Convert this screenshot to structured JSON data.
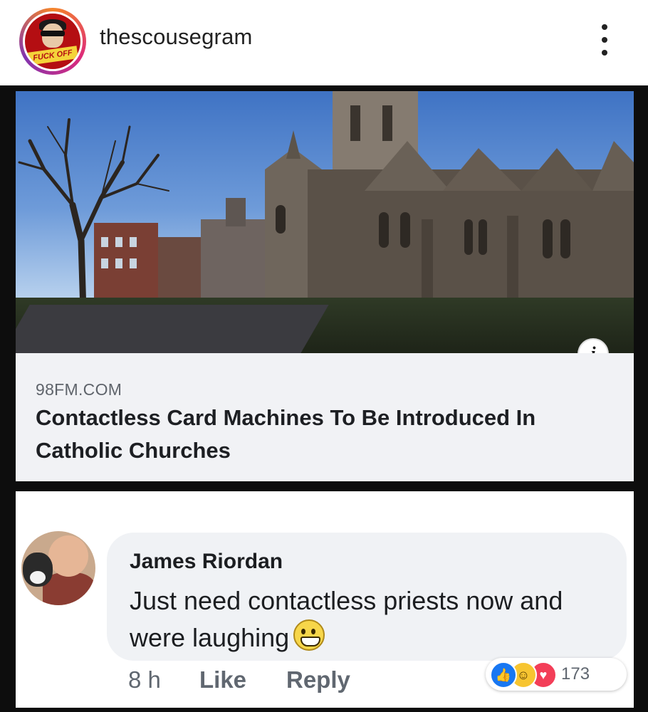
{
  "instagram": {
    "username": "thescousegram",
    "avatar_badge_text": "FUCK OFF",
    "menu_icon": "more-vertical-icon"
  },
  "link_card": {
    "domain": "98FM.COM",
    "headline": "Contactless Card Machines To Be Introduced In Catholic Churches",
    "info_icon_glyph": "i"
  },
  "comment": {
    "author": "James Riordan",
    "text": "Just need contactless priests now and were laughing",
    "emoji": "grinning-face-icon",
    "time": "8 h",
    "like_label": "Like",
    "reply_label": "Reply",
    "reaction_count": "173",
    "reactions": [
      "like-icon",
      "haha-icon",
      "love-icon"
    ]
  },
  "colors": {
    "facebook_blue": "#1877f2",
    "love_red": "#f33e58",
    "haha_yellow": "#f7c531"
  }
}
